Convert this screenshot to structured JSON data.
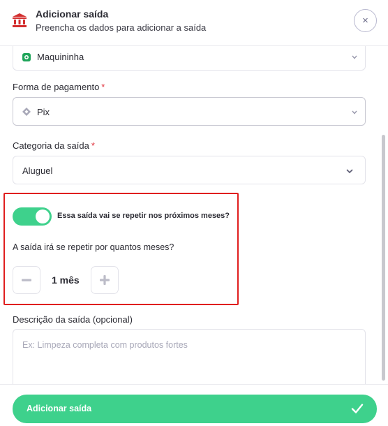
{
  "header": {
    "title": "Adicionar saída",
    "subtitle": "Preencha os dados para adicionar a saída",
    "close_icon": "×"
  },
  "form": {
    "account_select": {
      "value": "Maquininha"
    },
    "payment_method": {
      "label": "Forma de pagamento",
      "required_mark": "*",
      "value": "Pix"
    },
    "category": {
      "label": "Categoria da saída",
      "required_mark": "*",
      "value": "Aluguel"
    },
    "recurrence": {
      "toggle_label": "Essa saída vai se repetir nos próximos meses?",
      "toggle_on": true,
      "question": "A saída irá se repetir por quantos meses?",
      "months_value": "1 mês"
    },
    "description": {
      "label": "Descrição da saída (opcional)",
      "placeholder": "Ex: Limpeza completa com produtos fortes"
    }
  },
  "footer": {
    "submit_label": "Adicionar saída"
  },
  "colors": {
    "accent_green": "#3ed18c",
    "bank_icon_red": "#d32f2f",
    "required_red": "#e0303a",
    "highlight_red": "#e01e1e"
  },
  "icons": {
    "header": "bank-icon",
    "account": "card-reader-icon",
    "payment": "pix-icon",
    "close": "close-icon",
    "submit": "check-icon"
  }
}
